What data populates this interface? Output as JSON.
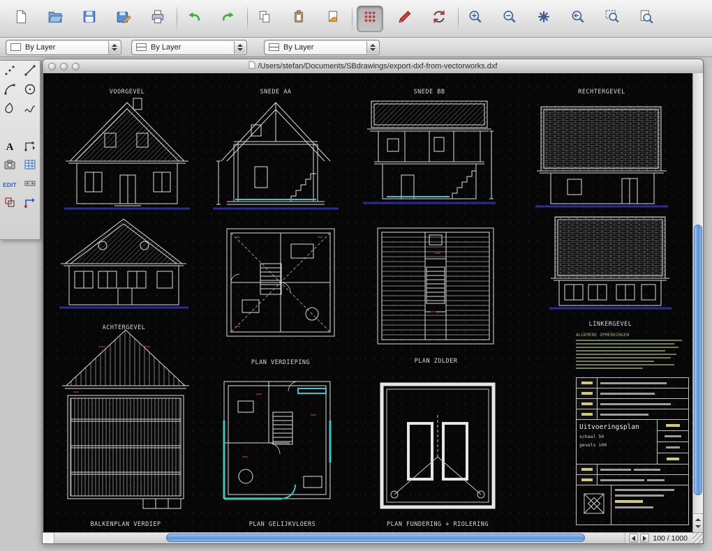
{
  "toolbar": {
    "icons": [
      "new-document",
      "open-folder",
      "save",
      "save-as",
      "print",
      "undo",
      "redo",
      "copy",
      "paste",
      "duplicate",
      "grid-toggle",
      "redline-marker",
      "refresh",
      "zoom-in",
      "zoom-out",
      "zoom-extents",
      "zoom-previous",
      "zoom-window",
      "zoom-page"
    ]
  },
  "layer_bar": {
    "combos": [
      {
        "value": "By Layer"
      },
      {
        "value": "By Layer"
      },
      {
        "value": "By Layer"
      }
    ]
  },
  "window": {
    "title": "/Users/stefan/Documents/SBdrawings/export-dxf-from-vectorworks.dxf"
  },
  "palette": {
    "tools": [
      "point-snap",
      "line",
      "arc",
      "circle",
      "shape",
      "spline",
      "text",
      "node-edit",
      "image",
      "table",
      "edit",
      "dimension",
      "copy-object",
      "transform"
    ],
    "text_tool_glyph": "A",
    "edit_label": "EDIT"
  },
  "canvas": {
    "drawings": [
      {
        "label": "VOORGEVEL"
      },
      {
        "label": "SNEDE AA"
      },
      {
        "label": "SNEDE BB"
      },
      {
        "label": "RECHTERGEVEL"
      },
      {
        "label": "ACHTERGEVEL"
      },
      {
        "label": "PLAN VERDIEPING"
      },
      {
        "label": "PLAN ZOLDER"
      },
      {
        "label": "LINKERGEVEL"
      },
      {
        "label": "BALKENPLAN VERDIEP"
      },
      {
        "label": "PLAN GELIJKVLOERS"
      },
      {
        "label": "PLAN FUNDERING + RIOLERING"
      }
    ],
    "notes": {
      "title": "ALGEMENE OPMERKINGEN"
    },
    "titleblock": {
      "title": "Uitvoeringsplan",
      "line1": "schaal 50",
      "line2": "gevels 100"
    }
  },
  "statusbar": {
    "page_indicator": "100 / 1000"
  },
  "colors": {
    "accent_teal": "#3fc6c0",
    "ground_blue": "#2b2b9e",
    "mark_red": "#d04040",
    "titleblock_yellow": "#d4c878",
    "notes_green": "#747c51"
  }
}
